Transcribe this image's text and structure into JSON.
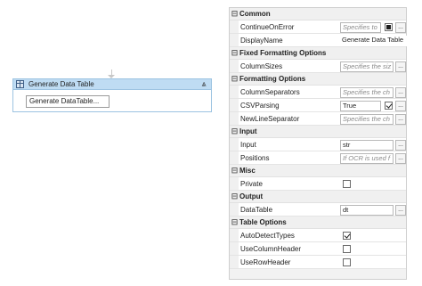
{
  "designer": {
    "activity_title": "Generate Data Table",
    "action_button": "Generate DataTable...",
    "collapse_glyph": "⩓"
  },
  "properties": {
    "categories": [
      {
        "label": "Common",
        "rows": [
          {
            "name": "ContinueOnError",
            "value": "Specifies to",
            "placeholder": true,
            "control": "filled-checkbox"
          },
          {
            "name": "DisplayName",
            "value": "Generate Data Table",
            "placeholder": false,
            "control": "plain"
          }
        ]
      },
      {
        "label": "Fixed Formatting Options",
        "rows": [
          {
            "name": "ColumnSizes",
            "value": "Specifies the siz",
            "placeholder": true,
            "control": "ellipsis"
          }
        ]
      },
      {
        "label": "Formatting Options",
        "rows": [
          {
            "name": "ColumnSeparators",
            "value": "Specifies the ch",
            "placeholder": true,
            "control": "ellipsis"
          },
          {
            "name": "CSVParsing",
            "value": "True",
            "placeholder": false,
            "control": "checkbox"
          },
          {
            "name": "NewLineSeparator",
            "value": "Specifies the ch",
            "placeholder": true,
            "control": "ellipsis"
          }
        ]
      },
      {
        "label": "Input",
        "rows": [
          {
            "name": "Input",
            "value": "str",
            "placeholder": false,
            "control": "ellipsis"
          },
          {
            "name": "Positions",
            "value": "If OCR is used f",
            "placeholder": true,
            "control": "ellipsis"
          }
        ]
      },
      {
        "label": "Misc",
        "rows": [
          {
            "name": "Private",
            "value": "",
            "control": "checkbox",
            "checked": false
          }
        ]
      },
      {
        "label": "Output",
        "rows": [
          {
            "name": "DataTable",
            "value": "dt",
            "placeholder": false,
            "control": "ellipsis"
          }
        ]
      },
      {
        "label": "Table Options",
        "rows": [
          {
            "name": "AutoDetectTypes",
            "value": "",
            "control": "checkbox",
            "checked": true
          },
          {
            "name": "UseColumnHeader",
            "value": "",
            "control": "checkbox",
            "checked": false
          },
          {
            "name": "UseRowHeader",
            "value": "",
            "control": "checkbox",
            "checked": false
          }
        ]
      }
    ],
    "collapse_glyph": "⊟",
    "ellipsis_label": "..."
  }
}
